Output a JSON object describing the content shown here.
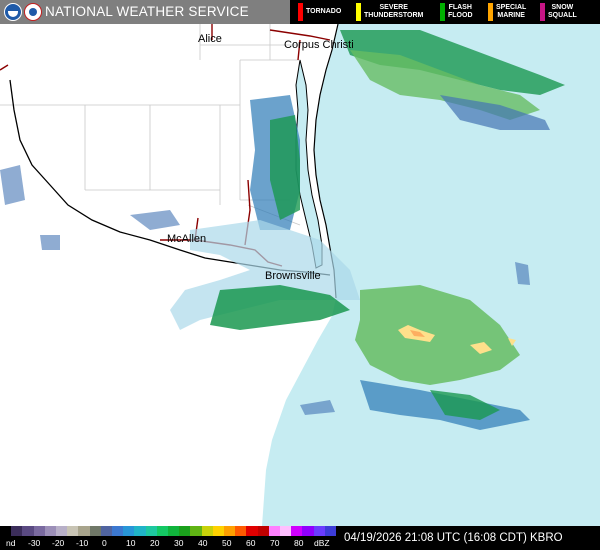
{
  "header": {
    "title": "NATIONAL WEATHER SERVICE",
    "logos": [
      "noaa-logo",
      "nws-logo"
    ]
  },
  "warnings_legend": [
    {
      "label_line1": "TORNADO",
      "label_line2": "",
      "color": "#ff0000"
    },
    {
      "label_line1": "SEVERE",
      "label_line2": "THUNDERSTORM",
      "color": "#ffff00"
    },
    {
      "label_line1": "FLASH",
      "label_line2": "FLOOD",
      "color": "#00b000"
    },
    {
      "label_line1": "SPECIAL",
      "label_line2": "MARINE",
      "color": "#ffa500"
    },
    {
      "label_line1": "SNOW",
      "label_line2": "SQUALL",
      "color": "#c71585"
    }
  ],
  "map": {
    "cities": [
      {
        "name": "Alice"
      },
      {
        "name": "Corpus Christi"
      },
      {
        "name": "McAllen"
      },
      {
        "name": "Brownsville"
      }
    ],
    "colors": {
      "land": "#ffffff",
      "water": "#c6ecf2",
      "borders": "#000000",
      "county_lines": "#c8c8c8",
      "highways": "#8b0000"
    }
  },
  "dbz_scale": {
    "labels": [
      "nd",
      "-30",
      "-20",
      "-10",
      "0",
      "10",
      "20",
      "30",
      "40",
      "50",
      "60",
      "70",
      "80",
      "dBZ"
    ],
    "colors": [
      "#000000",
      "#3b2d5a",
      "#5a4a82",
      "#7a6aa0",
      "#9c8fb8",
      "#b8b0c8",
      "#c8c4b4",
      "#a8a48c",
      "#707868",
      "#5064a0",
      "#3c78d0",
      "#2896d8",
      "#20b4c8",
      "#1ec8a0",
      "#14c864",
      "#10b43c",
      "#1aa01c",
      "#60b414",
      "#c8d20a",
      "#ffd200",
      "#ffa000",
      "#ff5a00",
      "#e00000",
      "#c00000",
      "#ff80ff",
      "#ffc0ff",
      "#d000ff",
      "#9000ff",
      "#6a3cff",
      "#3c3cd8"
    ]
  },
  "timestamp": "04/19/2026 21:08 UTC (16:08 CDT) KBRO"
}
